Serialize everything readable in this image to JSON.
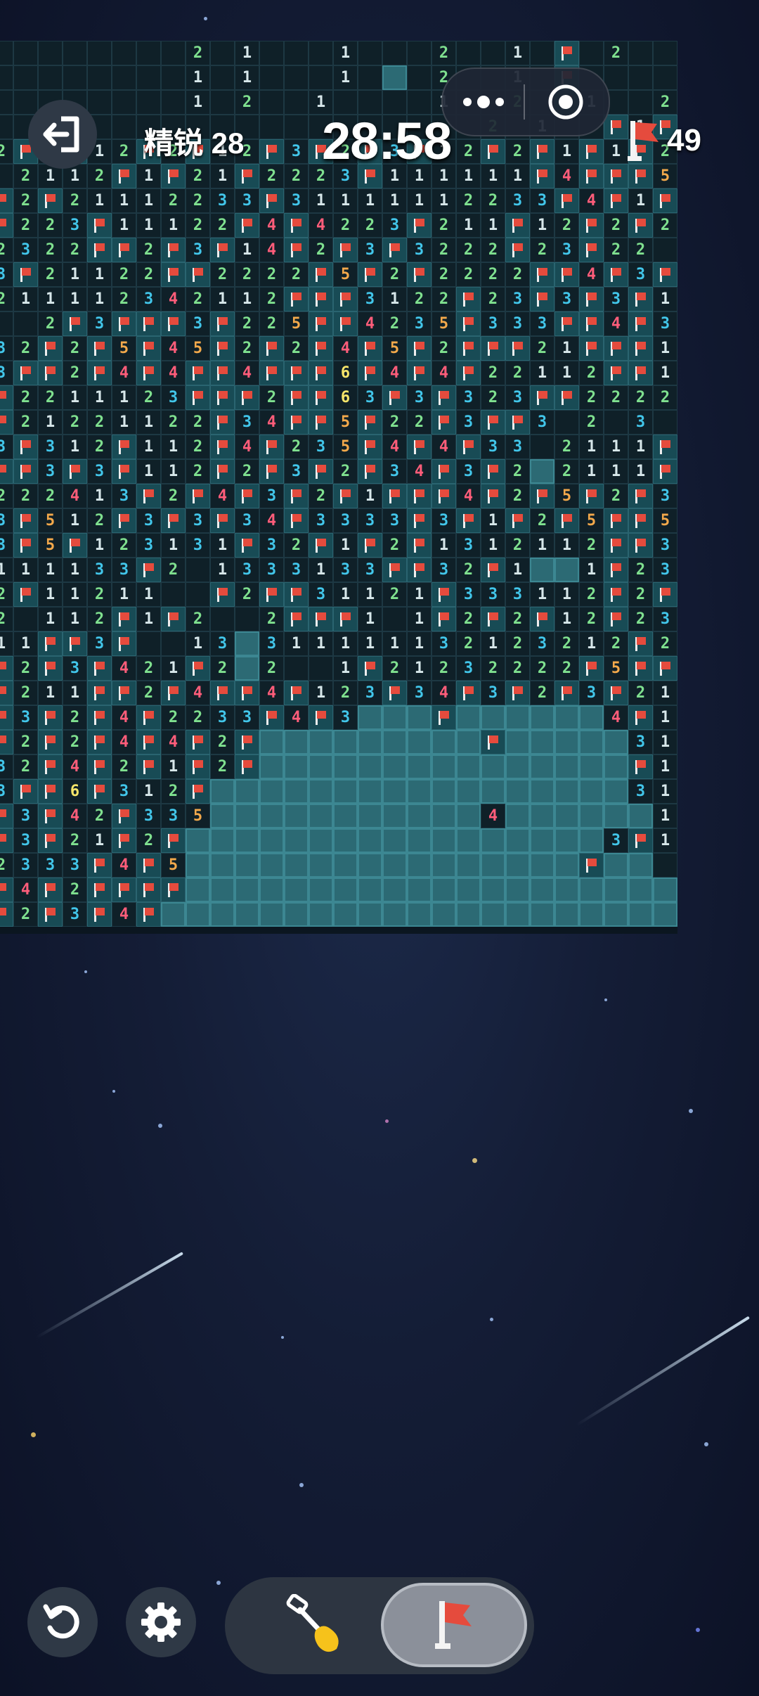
{
  "header": {
    "level_label": "精锐 28",
    "timer": "28:58",
    "flags_remaining": "49"
  },
  "icons": {
    "exit": "exit-icon",
    "more": "more-dots-icon",
    "close": "target-close-icon",
    "flag": "flag-icon",
    "restart": "restart-icon",
    "settings": "gear-icon",
    "dig": "shovel-icon"
  },
  "colors": {
    "number_1": "#d7e7ea",
    "number_2": "#7fe08f",
    "number_3": "#42c6ea",
    "number_4": "#ff5d7a",
    "number_5": "#f3a94b",
    "number_6": "#f6e56a",
    "closed_cell": "#2c6a74",
    "flag": "#e54b3d"
  },
  "board": {
    "legend": {
      "F": "flag",
      "#": "unopened",
      ".": "empty",
      "1-8": "adjacent mine count"
    },
    "rows": [
      "........2.1...1...2..1.F.2..",
      "........1.1...1.#.2..1.F....",
      "........1.2..1....1..2.F1..2",
      "....................2.1..F1F",
      "2F2F12F2F12F3F2F3F12F2F1F1F2",
      ".2112F1F21F2223F111111F4FFF5",
      "F2F21112233F31111112233F4F1F",
      "F223F11122F4F4223F211F12F2F2",
      "2322FF2F3F14F2F3F3222F23F22.",
      "3F21122FF2222F5F2F2222FF4F3F",
      "211112342112FFF3122F23F3F3F1",
      "..2F3FFF3F225FF4235F333FF4F3",
      "32F2F5F45F2F2F4F5F2FFF21FFF1",
      "3FF2F4F4FF4FFF6F4F4F22112FF1",
      "F2211123FFF2FF63F3F323FF2222",
      "F21221122F34FF5F22F3FF3.2.3.",
      "3F312F112F4F235F4F4F33.2111F",
      "FF3F3F112F2F3F2F34F3F2#2111F",
      "222413F2F4F3F2F1FFF4F2F5F2F3",
      "3F512F3F3F34F3333F3F1F2F5FF5",
      "3F5F123131F32F1F2F1312112FF3",
      "111133F2.1333133FF32F1##1F23",
      "2F11211..F2FF31121F333112F2F",
      "2.112F1F2..2FFF1.1F2F2F12F23",
      "11FF3F..13#311111132123212F2",
      "F2F3F421F2#2..1F21232222F5FF",
      "F211FF2F4FF4F123F34F3F2F3F21",
      "F3F2F4F2233F4F3###F######4F1",
      "F2F2F4F4F2F#########F#####31",
      "32F4F2F1F2F###############F1",
      "3FF6F312F#################31",
      "F3F42F335###########4######1",
      "F3F21F2F#################3F1",
      "2333F4F5################F##.",
      "F4F2FFFF####################",
      "F2F3F4F######################"
    ]
  }
}
